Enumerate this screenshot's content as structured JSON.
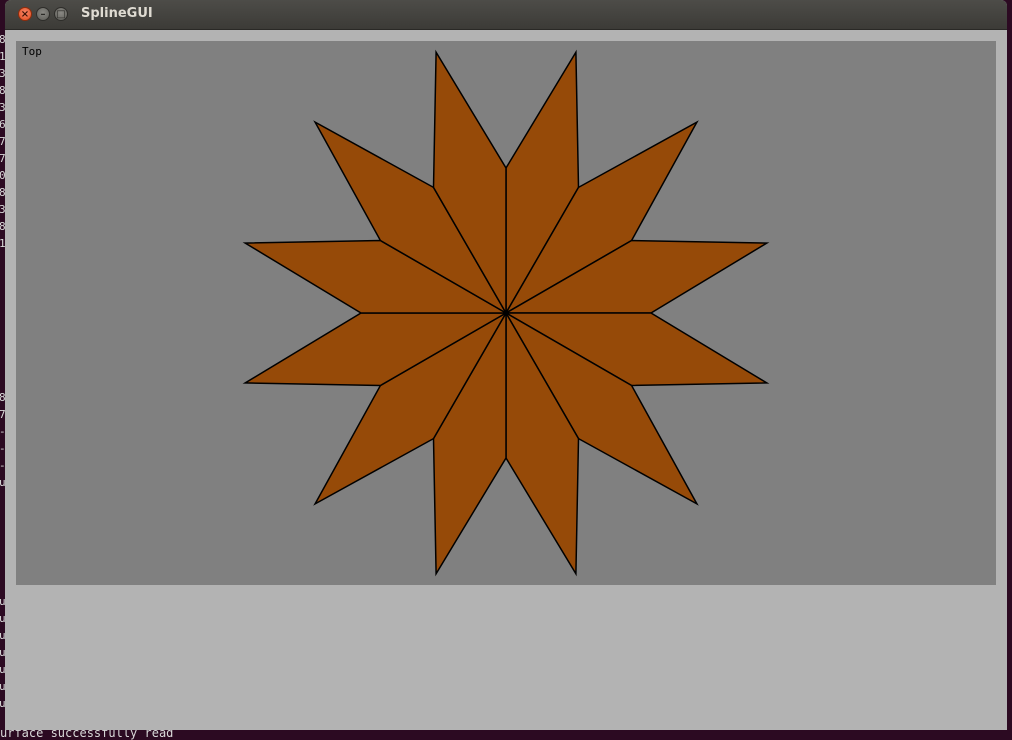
{
  "window": {
    "title": "SplineGUI"
  },
  "titlebar_buttons": {
    "close_glyph": "×",
    "minimize_glyph": "–",
    "maximize_glyph": "□"
  },
  "viewport": {
    "label": "Top",
    "background_color": "#808080",
    "shape_fill_color": "#964a08",
    "shape_stroke_color": "#000000",
    "shape": "12-point star"
  },
  "background_terminal": {
    "visible_left_chars": [
      "8",
      "1",
      "3",
      "8",
      "3",
      "6",
      "7",
      "7",
      "0",
      "8",
      "3",
      "8",
      "1",
      "8",
      "7",
      "-",
      "-",
      "-",
      "u",
      "u",
      "u",
      "u",
      "u",
      "u",
      "u",
      "u"
    ],
    "bottom_line": "urface successfully read"
  }
}
